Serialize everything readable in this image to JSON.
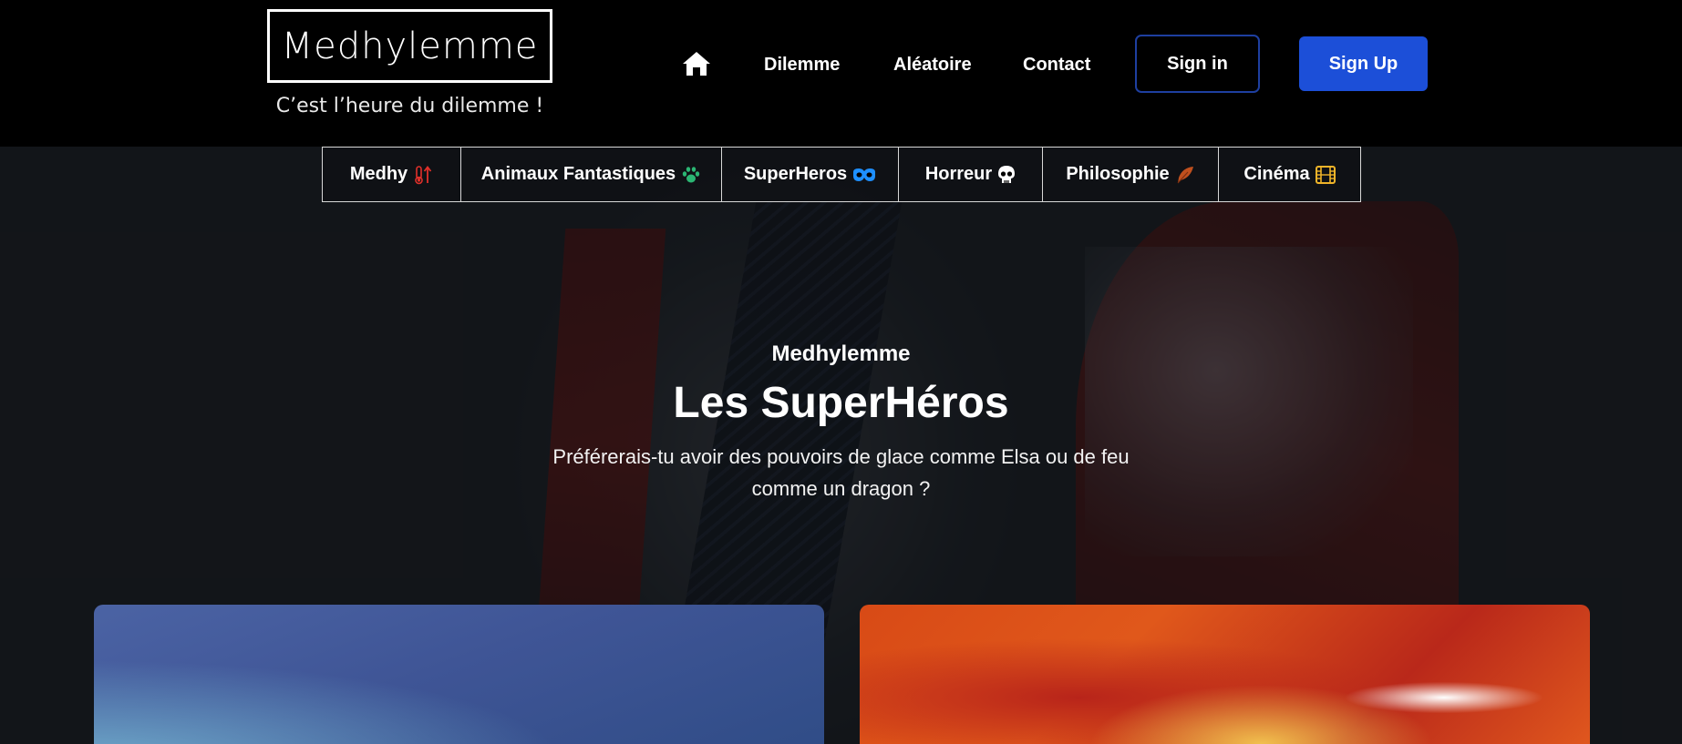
{
  "header": {
    "logo_text": "Medhylemme",
    "tagline": "C’est l’heure du dilemme !",
    "nav": {
      "home_icon": "home-icon",
      "dilemme": "Dilemme",
      "aleatoire": "Aléatoire",
      "contact": "Contact"
    },
    "sign_in": "Sign in",
    "sign_up": "Sign Up"
  },
  "categories": [
    {
      "label": "Medhy",
      "icon": "thermometer-arrows-icon",
      "icon_color": "#e0302a"
    },
    {
      "label": "Animaux Fantastiques",
      "icon": "paw-icon",
      "icon_color": "#2bb673"
    },
    {
      "label": "SuperHeros",
      "icon": "mask-icon",
      "icon_color": "#1e90ff"
    },
    {
      "label": "Horreur",
      "icon": "skull-icon",
      "icon_color": "#ffffff"
    },
    {
      "label": "Philosophie",
      "icon": "feather-icon",
      "icon_color": "#c0501e"
    },
    {
      "label": "Cinéma",
      "icon": "film-icon",
      "icon_color": "#f0b429"
    }
  ],
  "hero": {
    "eyebrow": "Medhylemme",
    "title": "Les SuperHéros",
    "question": "Préférerais-tu avoir des pouvoirs de glace comme Elsa ou de feu comme un dragon ?"
  },
  "colors": {
    "header_bg": "#000000",
    "signup_bg": "#1c4fd8",
    "signin_border": "#1e3fa0"
  }
}
